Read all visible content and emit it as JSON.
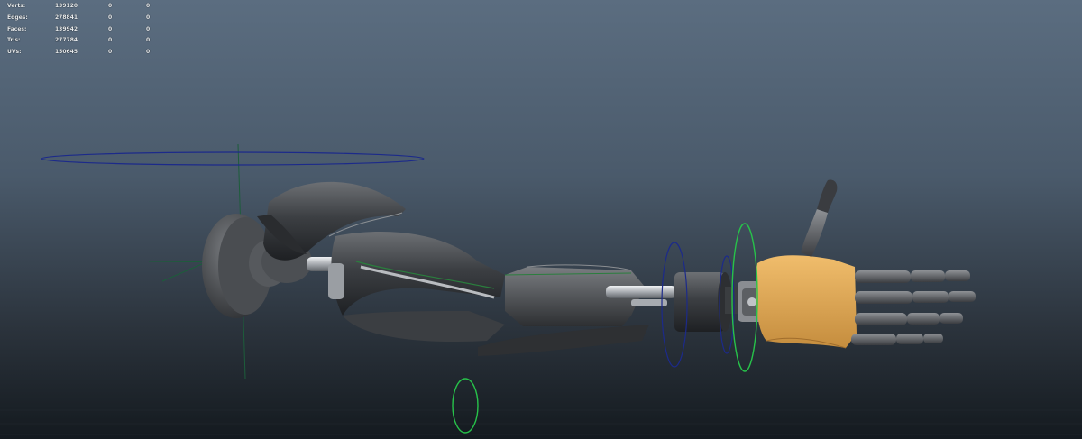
{
  "hud": {
    "rows": [
      {
        "label": "Verts:",
        "v1": "139120",
        "v2": "0",
        "v3": "0"
      },
      {
        "label": "Edges:",
        "v1": "278841",
        "v2": "0",
        "v3": "0"
      },
      {
        "label": "Faces:",
        "v1": "139942",
        "v2": "0",
        "v3": "0"
      },
      {
        "label": "Tris:",
        "v1": "277784",
        "v2": "0",
        "v3": "0"
      },
      {
        "label": "UVs:",
        "v1": "150645",
        "v2": "0",
        "v3": "0"
      }
    ]
  },
  "colors": {
    "viewport_top": "#5b6d80",
    "viewport_bottom": "#141a1f",
    "metal_dark": "#3a3d40",
    "metal_mid": "#5a5d61",
    "metal_light": "#9a9ea3",
    "chrome": "#c9ccd0",
    "hand_skin": "#e0a95a",
    "control_blue": "#1c2a8a",
    "control_green": "#27c24a",
    "joint_green": "#2f7a3a"
  },
  "scene": {
    "model": "robotic-arm-mesh",
    "controls": [
      "shoulder-control-ring",
      "elbow-control-ring",
      "forearm-control-ring",
      "wrist-control-ring",
      "hand-control-ring",
      "pole-vector-ring"
    ]
  }
}
